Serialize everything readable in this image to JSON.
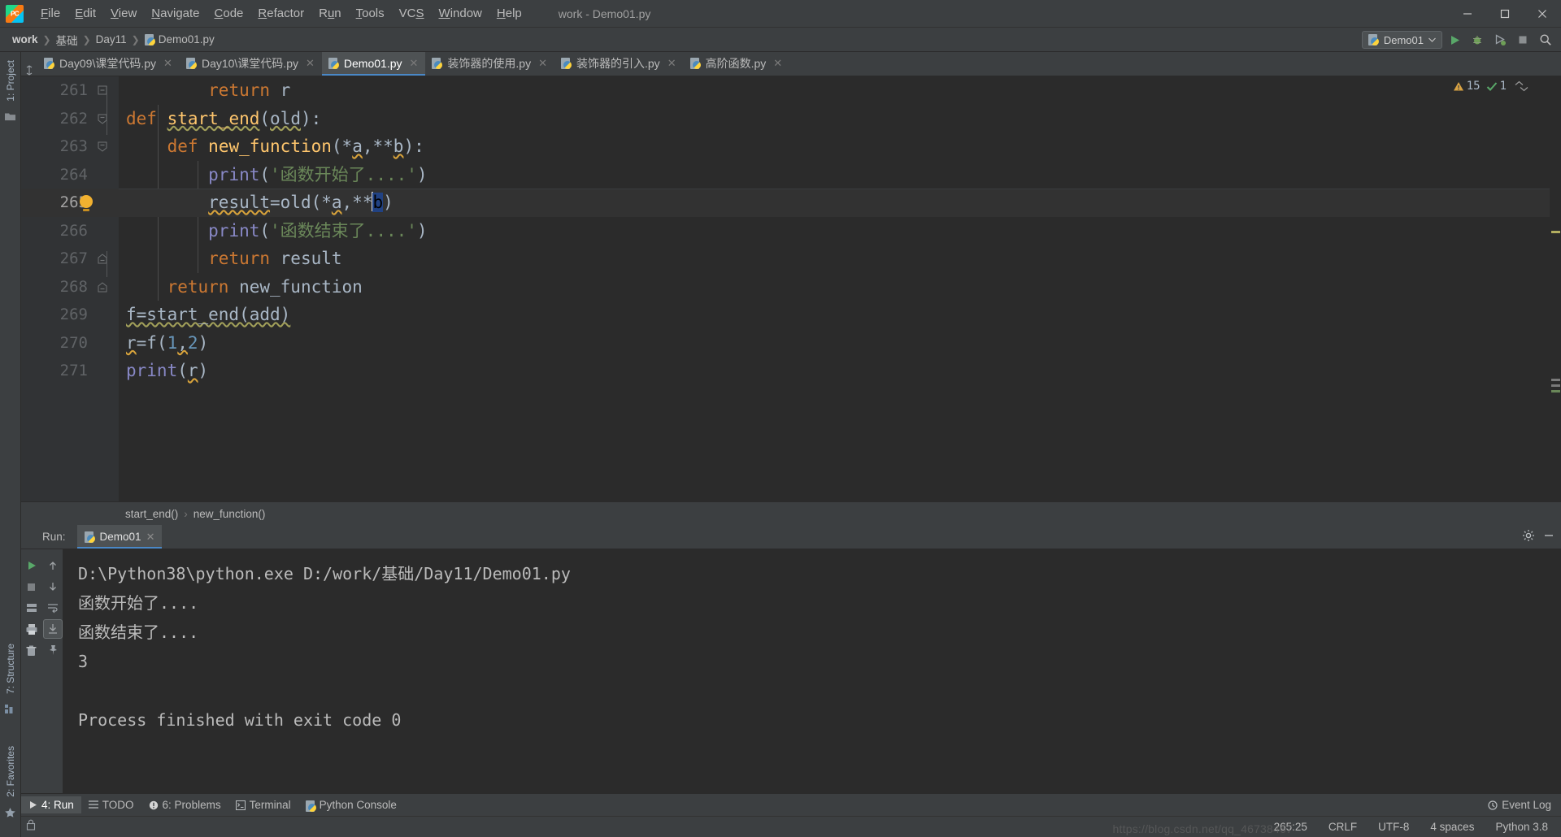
{
  "window": {
    "title": "work - Demo01.py",
    "app_icon": "pycharm-logo-icon",
    "minimize": "minimize-icon",
    "maximize": "maximize-icon",
    "close": "close-icon"
  },
  "menubar": {
    "items": [
      {
        "label": "File",
        "mnemonic": "F"
      },
      {
        "label": "Edit",
        "mnemonic": "E"
      },
      {
        "label": "View",
        "mnemonic": "V"
      },
      {
        "label": "Navigate",
        "mnemonic": "N"
      },
      {
        "label": "Code",
        "mnemonic": "C"
      },
      {
        "label": "Refactor",
        "mnemonic": "R"
      },
      {
        "label": "Run",
        "mnemonic": "n"
      },
      {
        "label": "Tools",
        "mnemonic": "T"
      },
      {
        "label": "VCS",
        "mnemonic": "S"
      },
      {
        "label": "Window",
        "mnemonic": "W"
      },
      {
        "label": "Help",
        "mnemonic": "H"
      }
    ]
  },
  "navbar": {
    "breadcrumbs": [
      "work",
      "基础",
      "Day11",
      "Demo01.py"
    ],
    "run_config": "Demo01",
    "actions": [
      "run-icon",
      "debug-icon",
      "run-coverage-icon",
      "stop-icon",
      "search-icon"
    ]
  },
  "left_tool_strip": {
    "labels": [
      "1: Project",
      "7: Structure",
      "2: Favorites"
    ]
  },
  "editor_tabs": [
    {
      "label": "Day09\\课堂代码.py",
      "active": false
    },
    {
      "label": "Day10\\课堂代码.py",
      "active": false
    },
    {
      "label": "Demo01.py",
      "active": true
    },
    {
      "label": "装饰器的使用.py",
      "active": false
    },
    {
      "label": "装饰器的引入.py",
      "active": false
    },
    {
      "label": "高阶函数.py",
      "active": false
    }
  ],
  "inspection": {
    "warnings": "15",
    "checks": "1",
    "warning_icon": "warning-triangle-icon",
    "check_icon": "checkmark-icon"
  },
  "editor": {
    "first_line": 261,
    "current_line": 265,
    "lines": [
      {
        "n": "261",
        "text": "        return r",
        "partial": true
      },
      {
        "n": "262",
        "text": "def start_end(old):"
      },
      {
        "n": "263",
        "text": "    def new_function(*a,**b):"
      },
      {
        "n": "264",
        "text": "        print('函数开始了....')"
      },
      {
        "n": "265",
        "text": "        result=old(*a,**b)"
      },
      {
        "n": "266",
        "text": "        print('函数结束了....')"
      },
      {
        "n": "267",
        "text": "        return result"
      },
      {
        "n": "268",
        "text": "    return new_function"
      },
      {
        "n": "269",
        "text": "f=start_end(add)"
      },
      {
        "n": "270",
        "text": "r=f(1,2)"
      },
      {
        "n": "271",
        "text": "print(r)"
      }
    ]
  },
  "editor_breadcrumb": {
    "items": [
      "start_end()",
      "new_function()"
    ],
    "separator": "›"
  },
  "run_panel": {
    "label": "Run:",
    "tab": "Demo01",
    "tab_icon": "python-icon",
    "settings_icon": "gear-icon",
    "minimize_icon": "minimize-panel-icon",
    "tool_buttons": [
      "rerun-icon",
      "stop-icon",
      "up-arrow-icon",
      "down-arrow-icon",
      "print-icon",
      "trash-icon",
      "soft-wrap-icon",
      "scroll-to-end-icon",
      "pin-icon"
    ],
    "console_output": [
      "D:\\Python38\\python.exe D:/work/基础/Day11/Demo01.py",
      "函数开始了....",
      "函数结束了....",
      "3",
      "",
      "Process finished with exit code 0"
    ]
  },
  "statusbar": {
    "left_items": [
      {
        "label": "4: Run",
        "mnemonic": "4",
        "icon": "run-triangle-icon",
        "active": true
      },
      {
        "label": "TODO",
        "mnemonic": "",
        "icon": "list-icon",
        "active": false
      },
      {
        "label": "6: Problems",
        "mnemonic": "6",
        "icon": "error-circle-icon",
        "active": false
      },
      {
        "label": "Terminal",
        "mnemonic": "",
        "icon": "terminal-icon",
        "active": false
      },
      {
        "label": "Python Console",
        "mnemonic": "",
        "icon": "python-icon",
        "active": false
      }
    ],
    "right_items": [
      {
        "label": "265:25",
        "name": "caret-position"
      },
      {
        "label": "CRLF",
        "name": "line-separator"
      },
      {
        "label": "UTF-8",
        "name": "file-encoding"
      },
      {
        "label": "4 spaces",
        "name": "indent-setting"
      },
      {
        "label": "Python 3.8",
        "name": "interpreter"
      }
    ],
    "event_log": "Event Log",
    "event_log_icon": "event-log-icon",
    "lock_icon": "lock-icon"
  },
  "watermark": "https://blog.csdn.net/qq_46738467",
  "colors": {
    "bg_chrome": "#3c3f41",
    "bg_editor": "#2b2b2b",
    "bg_gutter": "#313335",
    "accent_blue": "#4a88c7",
    "keyword": "#cc7832",
    "function": "#ffc66d",
    "string": "#6a8759",
    "number": "#6897bb",
    "builtin": "#8888c6",
    "plain": "#a9b7c6",
    "bulb": "#f2b130"
  }
}
